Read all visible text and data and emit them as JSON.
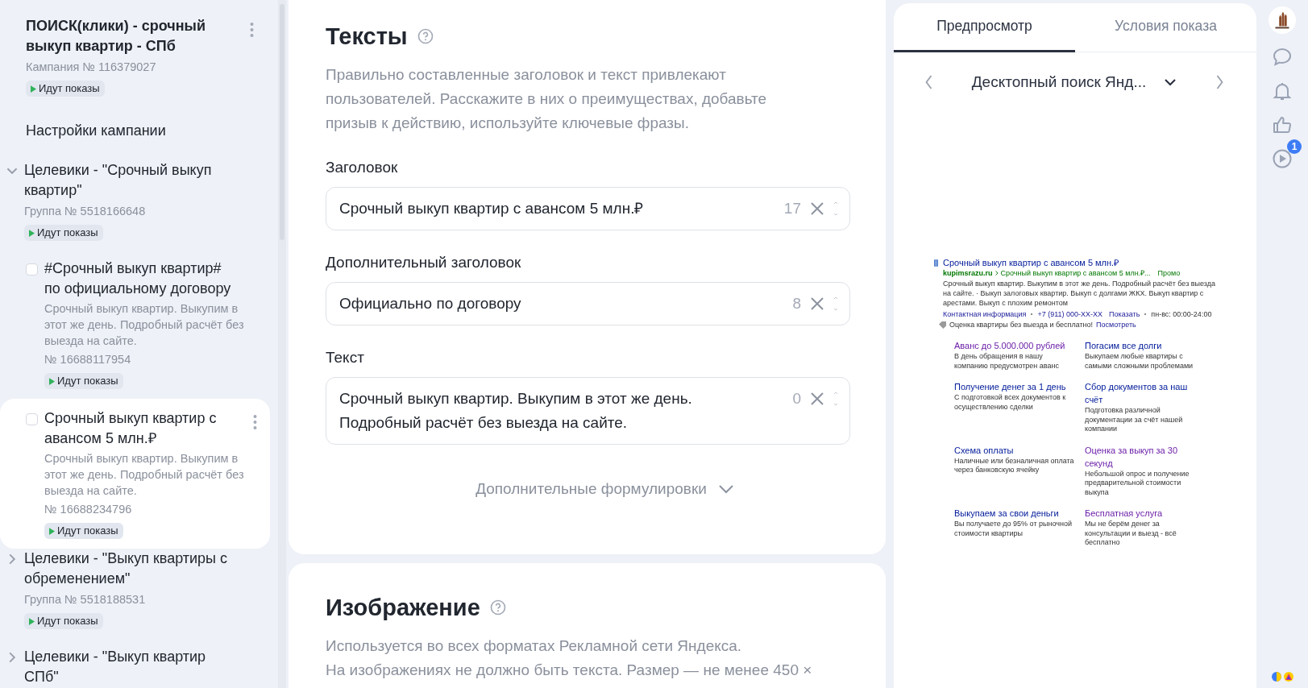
{
  "sidebar": {
    "items": [
      {
        "kind": "campaign",
        "title": "ПОИСК(клики) - срочный выкуп квартир - СПб",
        "subtitle": "Кампания № 116379027",
        "status": "Идут показы",
        "menu": true
      },
      {
        "kind": "settings",
        "title": "Настройки кампании"
      },
      {
        "kind": "group",
        "title": "Целевики - \"Срочный выкуп квартир\"",
        "subtitle": "Группа № 5518166648",
        "status": "Идут показы",
        "expanded": true,
        "children": [
          {
            "kind": "ad",
            "title": "#Срочный выкуп квартир# по официальному договору",
            "text": "Срочный выкуп квартир. Выкупим в этот же день. Подробный расчёт без выезда на сайте.",
            "number": "№ 16688117954",
            "status": "Идут показы",
            "checked": false,
            "menu": false,
            "selected": false
          },
          {
            "kind": "ad",
            "title": "Срочный выкуп квартир с авансом 5 млн.₽",
            "text": "Срочный выкуп квартир. Выкупим в этот же день. Подробный расчёт без выезда на сайте.",
            "number": "№ 16688234796",
            "status": "Идут показы",
            "checked": false,
            "menu": true,
            "selected": true
          }
        ]
      },
      {
        "kind": "group",
        "title": "Целевики - \"Выкуп квартиры с обременением\"",
        "subtitle": "Группа № 5518188531",
        "status": "Идут показы",
        "expanded": false
      },
      {
        "kind": "group",
        "title": "Целевики - \"Выкуп квартир СПб\"",
        "expanded": false
      }
    ]
  },
  "texts": {
    "title": "Тексты",
    "description": "Правильно составленные заголовок и текст привлекают пользователей. Расскажите в них о преимуществах, добавьте призыв к действию, используйте ключевые фразы.",
    "fields": [
      {
        "label": "Заголовок",
        "value": "Срочный выкуп квартир с авансом 5 млн.₽",
        "counter": "17"
      },
      {
        "label": "Дополнительный заголовок",
        "value": "Официально по договору",
        "counter": "8"
      },
      {
        "label": "Текст",
        "value": "Срочный выкуп квартир. Выкупим в этот же день. Подробный расчёт без выезда на сайте.",
        "counter": "0"
      }
    ],
    "more": "Дополнительные формулировки"
  },
  "image": {
    "title": "Изображение",
    "lines": [
      "Используется во всех форматах Рекламной сети Яндекса.",
      "На изображениях не должно быть текста. Размер — не менее 450 ×"
    ]
  },
  "preview": {
    "tabs": [
      {
        "label": "Предпросмотр",
        "selected": true
      },
      {
        "label": "Условия показа",
        "selected": false
      }
    ],
    "device": "Десктопный поиск Янд...",
    "ad": {
      "title": "Срочный выкуп квартир с авансом 5 млн.₽",
      "domain": "kupimsrazu.ru",
      "path": "Срочный выкуп квартир с авансом 5 млн.₽...",
      "promo": "Промо",
      "text": "Срочный выкуп квартир. Выкупим в этот же день. Подробный расчёт без выезда на сайте. · Выкуп залоговых квартир. Выкуп с долгами ЖКХ. Выкуп квартир с арестами. Выкуп с плохим ремонтом",
      "contacts": [
        {
          "text": "Контактная информация",
          "kind": "link"
        },
        {
          "text": "+7 (911) 000-XX-XX",
          "kind": "link"
        },
        {
          "text": "Показать",
          "kind": "link"
        },
        {
          "text": "пн-вс: 00:00-24:00",
          "kind": "plain"
        }
      ],
      "callout": "Оценка квартиры без выезда и бесплатно!",
      "callout_link": "Посмотреть",
      "sitelinks": [
        {
          "title": "Аванс до 5.000.000 рублей",
          "text": "В день обращения в нашу компанию предусмотрен аванс",
          "visited": true
        },
        {
          "title": "Погасим все долги",
          "text": "Выкупаем любые квартиры с самыми сложными проблемами",
          "visited": false
        },
        {
          "title": "Получение денег за 1 день",
          "text": "С подготовкой всех документов к осуществлению сделки",
          "visited": false
        },
        {
          "title": "Сбор документов за наш счёт",
          "text": "Подготовка различной документации за счёт нашей компании",
          "visited": false
        },
        {
          "title": "Схема оплаты",
          "text": "Наличные или безналичная оплата через банковскую ячейку",
          "visited": false
        },
        {
          "title": "Оценка за выкуп за 30 секунд",
          "text": "Небольшой опрос и получение предварительной стоимости выкупа",
          "visited": true
        },
        {
          "title": "Выкупаем за свои деньги",
          "text": "Вы получаете до 95% от рыночной стоимости квартиры",
          "visited": false
        },
        {
          "title": "Бесплатная услуга",
          "text": "Мы не берём денег за консультации и выезд - всё бесплатно",
          "visited": true
        }
      ]
    }
  },
  "rail": {
    "badge": "1"
  }
}
